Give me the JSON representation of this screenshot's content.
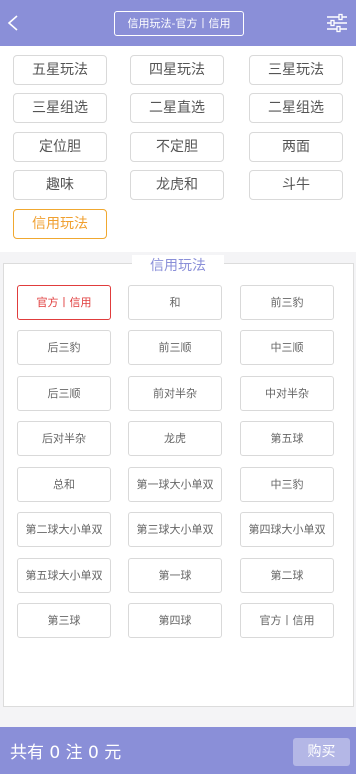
{
  "header": {
    "title": "信用玩法-官方丨信用",
    "back_icon": "chevron-left-icon",
    "settings_icon": "sliders-icon"
  },
  "categories": [
    {
      "label": "五星玩法"
    },
    {
      "label": "四星玩法"
    },
    {
      "label": "三星玩法"
    },
    {
      "label": "三星组选"
    },
    {
      "label": "二星直选"
    },
    {
      "label": "二星组选"
    },
    {
      "label": "定位胆"
    },
    {
      "label": "不定胆"
    },
    {
      "label": "两面"
    },
    {
      "label": "趣味"
    },
    {
      "label": "龙虎和"
    },
    {
      "label": "斗牛"
    },
    {
      "label": "信用玩法",
      "active": true
    }
  ],
  "panel": {
    "title": "信用玩法",
    "items": [
      {
        "label": "官方丨信用",
        "active": true
      },
      {
        "label": "和"
      },
      {
        "label": "前三豹"
      },
      {
        "label": "后三豹"
      },
      {
        "label": "前三顺"
      },
      {
        "label": "中三顺"
      },
      {
        "label": "后三顺"
      },
      {
        "label": "前对半杂"
      },
      {
        "label": "中对半杂"
      },
      {
        "label": "后对半杂"
      },
      {
        "label": "龙虎"
      },
      {
        "label": "第五球"
      },
      {
        "label": "总和"
      },
      {
        "label": "第一球大小单双"
      },
      {
        "label": "中三豹"
      },
      {
        "label": "第二球大小单双"
      },
      {
        "label": "第三球大小单双"
      },
      {
        "label": "第四球大小单双"
      },
      {
        "label": "第五球大小单双"
      },
      {
        "label": "第一球"
      },
      {
        "label": "第二球"
      },
      {
        "label": "第三球"
      },
      {
        "label": "第四球"
      },
      {
        "label": "官方丨信用"
      }
    ]
  },
  "footer": {
    "summary": "共有 0 注  0 元",
    "buy_label": "购买"
  },
  "colors": {
    "header_bg": "#8a8fd8",
    "active_category": "#f0a030",
    "active_item": "#e03c3c"
  }
}
